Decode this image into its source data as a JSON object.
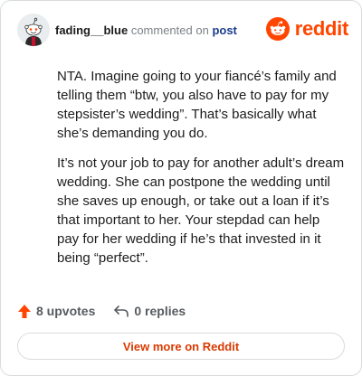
{
  "header": {
    "username": "fading__blue",
    "action_text": "commented on",
    "post_link": "post",
    "brand": "reddit"
  },
  "comment": {
    "paragraphs": [
      "NTA. Imagine going to your fiancé’s family and telling them “btw, you also have to pay for my stepsister’s wedding”. That’s basically what she’s demanding you do.",
      "It’s not your job to pay for another adult’s dream wedding. She can postpone the wedding until she saves up enough, or take out a loan if it’s that important to her. Your stepdad can help pay for her wedding if he’s that invested in it being “perfect”."
    ]
  },
  "actions": {
    "upvotes": "8 upvotes",
    "replies": "0 replies"
  },
  "footer": {
    "view_more": "View more on Reddit"
  },
  "colors": {
    "brand": "#ff4500",
    "link": "#1a3c8c",
    "button_text": "#d93a00"
  }
}
